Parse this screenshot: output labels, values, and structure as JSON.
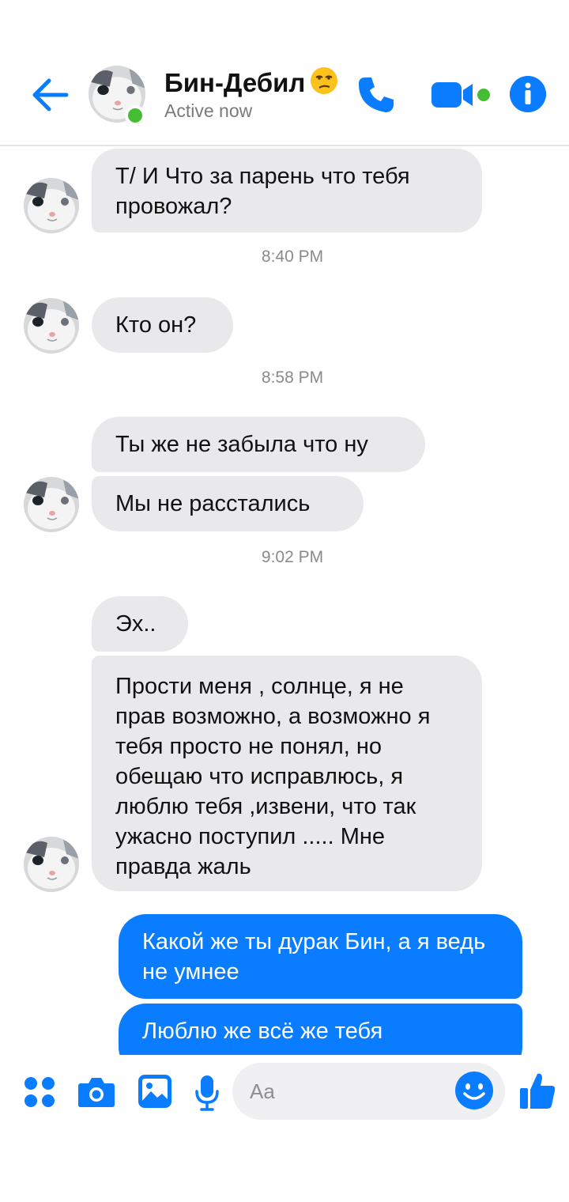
{
  "header": {
    "contact_name": "Бин-Дебил",
    "status": "Active now",
    "icons": [
      "back-arrow-icon",
      "avatar",
      "phone-icon",
      "video-icon",
      "info-icon",
      "unamused-face-emoji"
    ]
  },
  "messages": [
    {
      "side": "in",
      "text": "Т/ И  Что за парень что тебя провожал?"
    },
    {
      "type": "timestamp",
      "text": "8:40 PM"
    },
    {
      "side": "in",
      "text": "Кто он?"
    },
    {
      "type": "timestamp",
      "text": "8:58 PM"
    },
    {
      "side": "in",
      "text": "Ты же не забыла что ну"
    },
    {
      "side": "in",
      "text": "Мы не расстались"
    },
    {
      "type": "timestamp",
      "text": "9:02 PM"
    },
    {
      "side": "in",
      "text": "Эх.."
    },
    {
      "side": "in",
      "text": "Прости меня , солнце, я не прав возможно, а возможно я тебя просто не понял, но обещаю что исправлюсь, я люблю тебя ,извени, что так ужасно поступил  ..... Мне правда жаль"
    },
    {
      "side": "out",
      "text": "Какой же ты дурак Бин, а я ведь не умнее"
    },
    {
      "side": "out",
      "text": "Люблю же всё же тебя"
    }
  ],
  "composer": {
    "placeholder": "Aa",
    "icons": [
      "apps-icon",
      "camera-icon",
      "gallery-icon",
      "microphone-icon",
      "emoji-icon",
      "thumbs-up-icon"
    ]
  },
  "colors": {
    "accent": "#0a7cff",
    "incoming_bubble": "#e9e9eb",
    "online": "#44bd32",
    "timestamp": "#8a8a8a"
  }
}
